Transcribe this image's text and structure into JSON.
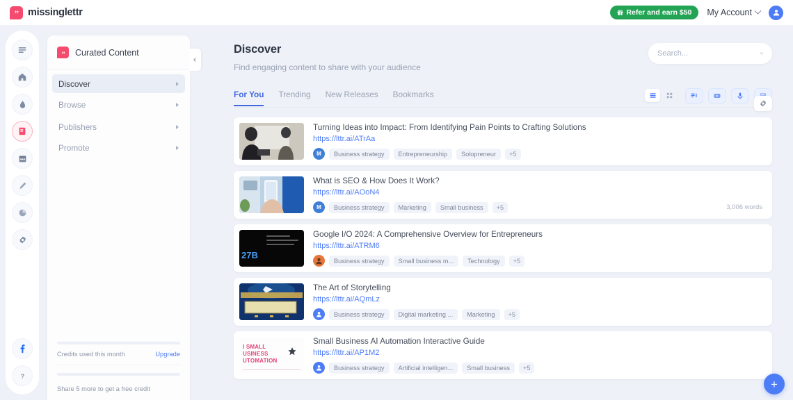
{
  "topbar": {
    "brand": "missinglettr",
    "refer_label": "Refer and earn $50",
    "account_label": "My Account"
  },
  "rail": {
    "items": [
      {
        "name": "menu-icon"
      },
      {
        "name": "home-icon"
      },
      {
        "name": "drip-icon"
      },
      {
        "name": "curated-content-icon"
      },
      {
        "name": "calendar-icon"
      },
      {
        "name": "compose-icon"
      },
      {
        "name": "analytics-icon"
      },
      {
        "name": "settings-icon"
      }
    ],
    "bottom": [
      {
        "name": "facebook-icon"
      },
      {
        "name": "help-icon"
      }
    ]
  },
  "panel": {
    "title": "Curated Content",
    "nav": [
      {
        "label": "Discover",
        "active": true
      },
      {
        "label": "Browse",
        "active": false
      },
      {
        "label": "Publishers",
        "active": false
      },
      {
        "label": "Promote",
        "active": false
      }
    ],
    "footer": {
      "credits_label": "Credits used this month",
      "upgrade_label": "Upgrade",
      "share_label": "Share 5 more to get a free credit"
    }
  },
  "main": {
    "title": "Discover",
    "subtitle": "Find engaging content to share with your audience",
    "search_placeholder": "Search...",
    "search_value": "",
    "tabs": [
      {
        "label": "For You",
        "active": true
      },
      {
        "label": "Trending",
        "active": false
      },
      {
        "label": "New Releases",
        "active": false
      },
      {
        "label": "Bookmarks",
        "active": false
      }
    ],
    "view_toggle": [
      {
        "name": "list-view-icon",
        "active": true
      },
      {
        "name": "grid-view-icon",
        "active": false
      }
    ],
    "filters": [
      {
        "name": "article-filter-icon"
      },
      {
        "name": "video-filter-icon"
      },
      {
        "name": "podcast-filter-icon"
      },
      {
        "name": "presentation-filter-icon"
      }
    ],
    "settings_icon": "gear-icon",
    "fab_label": "+"
  },
  "cards": [
    {
      "title": "Turning Ideas into Impact: From Identifying Pain Points to Crafting Solutions",
      "url": "https://lttr.ai/ATrAa",
      "avatar_text": "M",
      "avatar_style": "blue",
      "tags": [
        "Business strategy",
        "Entrepreneurship",
        "Solopreneur"
      ],
      "more_tags": "+5",
      "words": "",
      "thumb": "t1"
    },
    {
      "title": "What is SEO & How Does It Work?",
      "url": "https://lttr.ai/AOoN4",
      "avatar_text": "M",
      "avatar_style": "blue",
      "tags": [
        "Business strategy",
        "Marketing",
        "Small business"
      ],
      "more_tags": "+5",
      "words": "3,006 words",
      "thumb": "t2"
    },
    {
      "title": "Google I/O 2024: A Comprehensive Overview for Entrepreneurs",
      "url": "https://lttr.ai/ATRM6",
      "avatar_text": "",
      "avatar_style": "orange",
      "tags": [
        "Business strategy",
        "Small business m...",
        "Technology"
      ],
      "more_tags": "+5",
      "words": "",
      "thumb": "t3",
      "thumb_text": "27B"
    },
    {
      "title": "The Art of Storytelling",
      "url": "https://lttr.ai/AQmLz",
      "avatar_text": "",
      "avatar_style": "solid",
      "tags": [
        "Business strategy",
        "Digital marketing ...",
        "Marketing"
      ],
      "more_tags": "+5",
      "words": "",
      "thumb": "t4"
    },
    {
      "title": "Small Business AI Automation Interactive Guide",
      "url": "https://lttr.ai/AP1M2",
      "avatar_text": "",
      "avatar_style": "solid",
      "tags": [
        "Business strategy",
        "Artificial intelligen...",
        "Small business"
      ],
      "more_tags": "+5",
      "words": "",
      "thumb": "t5",
      "thumb_text": "I SMALL\nUSINESS\nUTOMATION"
    }
  ],
  "colors": {
    "brand_pink": "#f64b6e",
    "accent_blue": "#4d7cf7",
    "tab_blue": "#4069e0",
    "refer_green": "#23a455",
    "page_bg": "#eef1f7"
  }
}
